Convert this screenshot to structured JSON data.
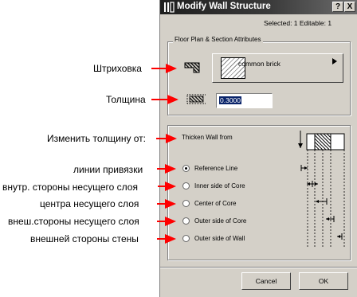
{
  "dialog": {
    "title": "Modify Wall Structure",
    "help_label": "?",
    "close_label": "X",
    "status": "Selected: 1 Editable: 1",
    "floor_group": {
      "label": "Floor Plan & Section Attributes",
      "fill_name": "common brick",
      "thickness_value": "0.3000"
    },
    "thicken_group": {
      "label": "Thicken Wall from",
      "options": [
        {
          "label": "Reference Line",
          "selected": true
        },
        {
          "label": "Inner side of Core",
          "selected": false
        },
        {
          "label": "Center of Core",
          "selected": false
        },
        {
          "label": "Outer side of Core",
          "selected": false
        },
        {
          "label": "Outer side of Wall",
          "selected": false
        }
      ]
    },
    "buttons": {
      "cancel": "Cancel",
      "ok": "OK"
    }
  },
  "annotations": {
    "fill": "Штриховка",
    "thickness": "Толщина",
    "change_thickness": "Изменить толщину от:",
    "options": [
      "линии привязки",
      "внутр. стороны несущего слоя",
      "центра несущего слоя",
      "внеш.стороны несущего слоя",
      "внешней стороны стены"
    ]
  },
  "colors": {
    "arrow": "#ff0000",
    "dialog_bg": "#d4d0c8",
    "title_bar": "#1e1e1e"
  }
}
